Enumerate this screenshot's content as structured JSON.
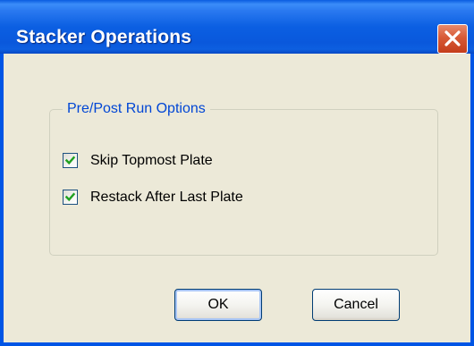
{
  "window": {
    "title": "Stacker Operations",
    "close_icon": "close-icon"
  },
  "group": {
    "legend": "Pre/Post Run Options"
  },
  "options": [
    {
      "label": "Skip Topmost Plate",
      "checked": true
    },
    {
      "label": "Restack After Last Plate",
      "checked": true
    }
  ],
  "buttons": {
    "ok": "OK",
    "cancel": "Cancel"
  },
  "colors": {
    "title_bar": "#0a5ce0",
    "close_button": "#d85a36",
    "group_legend": "#0046d5",
    "dialog_face": "#ece9d8",
    "check_mark": "#21a121"
  }
}
